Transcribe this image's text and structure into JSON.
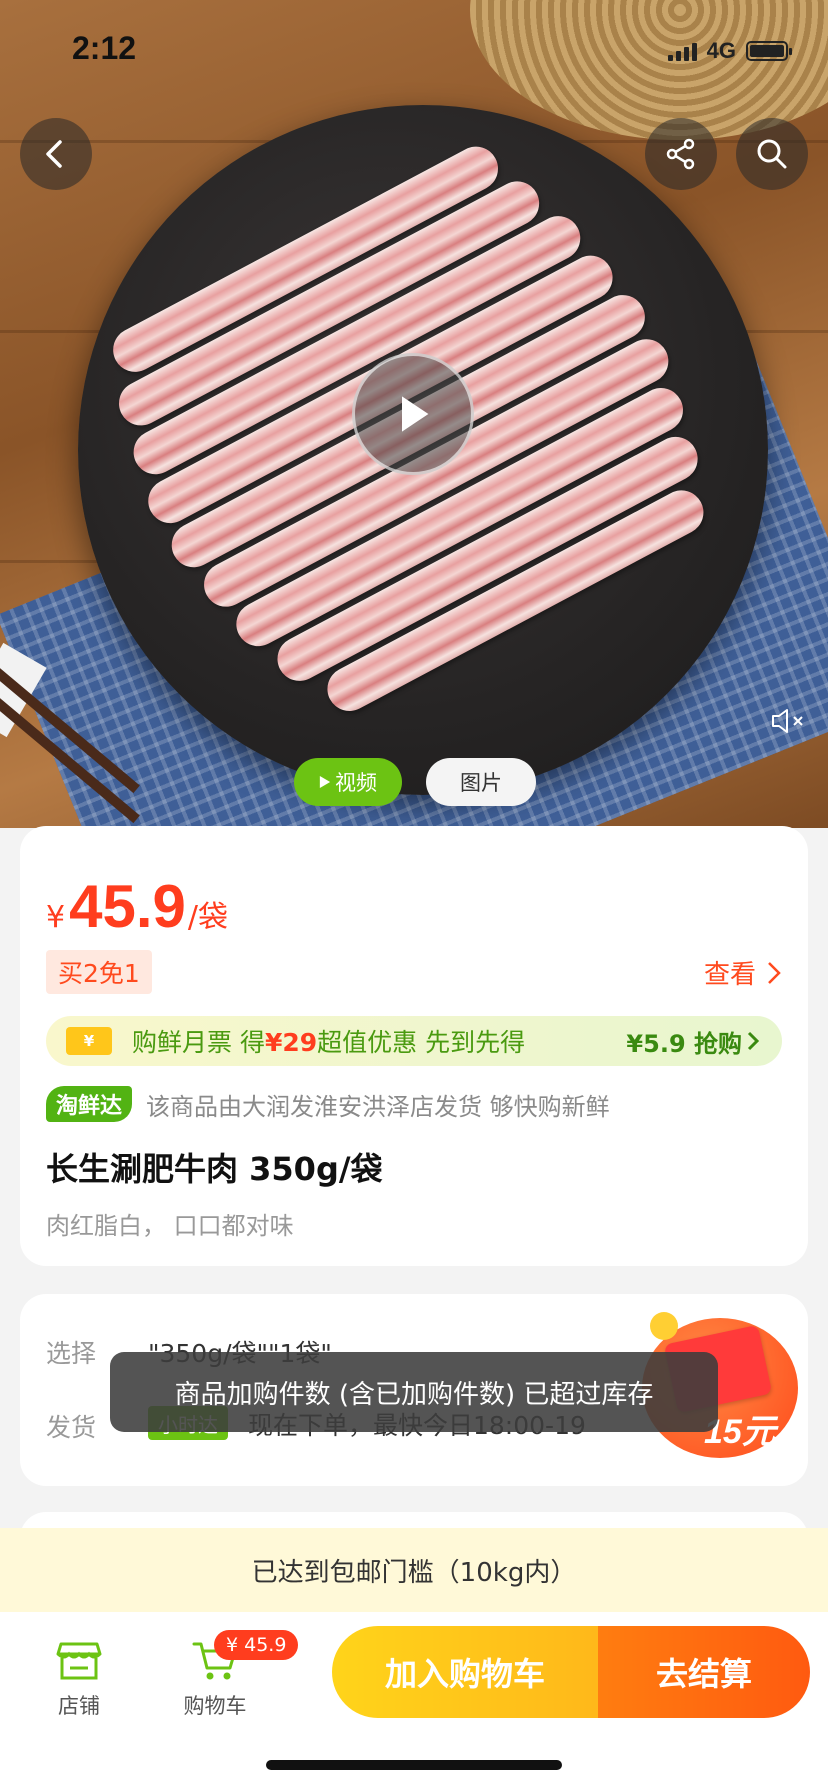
{
  "status_bar": {
    "time": "2:12",
    "network": "4G"
  },
  "media": {
    "tab_video": "视频",
    "tab_photo": "图片"
  },
  "product": {
    "currency": "¥",
    "price": "45.9",
    "unit": "/袋",
    "promo_tag": "买2免1",
    "see_more": "查看",
    "coupon": {
      "icon_text": "¥",
      "prefix": "购鲜月票 得",
      "amount": "¥29",
      "suffix": "超值优惠 先到先得",
      "cta": "¥5.9 抢购"
    },
    "fresh_badge": "淘鲜达",
    "shipping_text": "该商品由大润发淮安洪泽店发货 够快购新鲜",
    "title": "长生涮肥牛肉 350g/袋",
    "subtitle": "肉红脂白， 口口都对味"
  },
  "selection": {
    "select_label": "选择",
    "select_value": "\"350g/袋\"\"1袋\"",
    "delivery_label": "发货",
    "delivery_badge": "小时达",
    "delivery_text": "现在下单，最快今日18:00-19",
    "envelope_amount": "15元"
  },
  "toast": "商品加购件数 (含已加购件数) 已超过库存",
  "free_shipping": "已达到包邮门槛（10kg内）",
  "bottom_bar": {
    "store_label": "店铺",
    "cart_label": "购物车",
    "cart_badge": "¥ 45.9",
    "add_to_cart": "加入购物车",
    "checkout": "去结算"
  },
  "colors": {
    "accent_red": "#ff3d1e",
    "accent_green": "#6cc313",
    "cta_yellow": "#ffc61a",
    "cta_orange": "#ff6a10"
  }
}
